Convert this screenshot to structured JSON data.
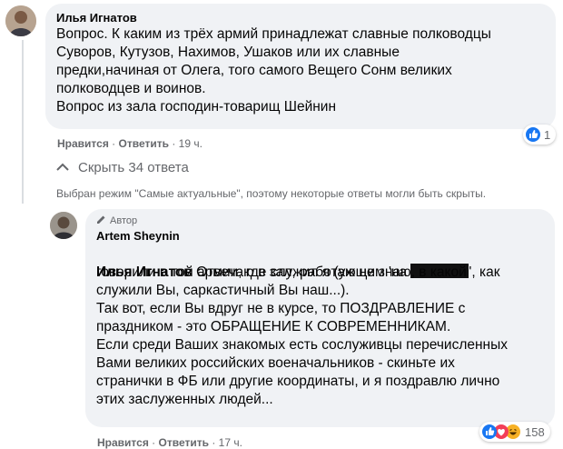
{
  "comment1": {
    "author": "Илья Игнатов",
    "text": "Вопрос. К каким из трёх армий принадлежат славные полководцы\nСуворов, Кутузов, Нахимов, Ушаков или их славные\nпредки,начиная от Олега, того самого Вещего Сонм великих\nполководцев и воинов.\nВопрос из зала господин-товарищ Шейнин",
    "like_label": "Нравится",
    "reply_label": "Ответить",
    "time": "19 ч.",
    "reaction_count": "1"
  },
  "replies": {
    "hide_label": "Скрыть 34 ответа",
    "mode_notice": "Выбран режим \"Самые актуальные\", поэтому некоторые ответы могли быть скрыты."
  },
  "comment2": {
    "author_badge": "Автор",
    "author": "Artem Sheynin",
    "mention": "Илья Игнатов",
    "line1a": " Отвечаю в зал, работающим 'на ",
    "line1b": "', как",
    "text_rest": "говорили в той армии, где служил я (уж не знаю, в какой\nслужили Вы, саркастичный Вы наш...).\nТак вот, если Вы вдруг не в курсе, то ПОЗДРАВЛЕНИЕ с\nпраздником - это ОБРАЩЕНИЕ К СОВРЕМЕННИКАМ.\nЕсли среди Ваших знакомых есть сослуживцы перечисленных\nВами великих российских военачальников - скиньте их\nстранички в ФБ или другие координаты, и я поздравлю лично\nэтих заслуженных людей...",
    "like_label": "Нравится",
    "reply_label": "Ответить",
    "time": "17 ч.",
    "reaction_count": "158"
  },
  "colors": {
    "bubble": "#f0f2f5",
    "like_blue": "#1877f2",
    "love_red": "#f33e58",
    "haha_yellow": "#f7b125"
  },
  "icons": [
    "avatar",
    "like-reaction-icon",
    "love-reaction-icon",
    "haha-reaction-icon",
    "chevron-up-icon",
    "pencil-icon"
  ]
}
